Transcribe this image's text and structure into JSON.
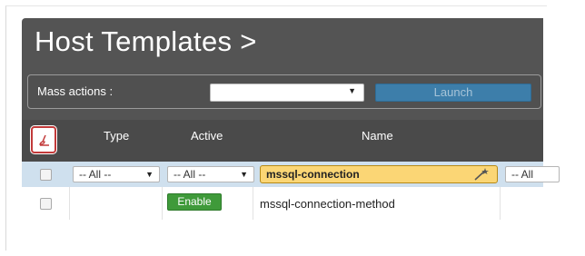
{
  "header": {
    "title": "Host Templates >"
  },
  "mass_actions": {
    "label": "Mass actions :",
    "selected": "",
    "launch_label": "Launch"
  },
  "table": {
    "columns": [
      "Type",
      "Active",
      "Name"
    ],
    "filters": {
      "type": "-- All --",
      "active": "-- All --",
      "name": "mssql-connection",
      "next": "-- All"
    },
    "rows": [
      {
        "type": "",
        "active": "Enable",
        "name": "mssql-connection-method"
      }
    ]
  },
  "icons": {
    "clear_filters": "broom-icon",
    "filter_wand": "magic-wand-icon"
  },
  "colors": {
    "header_bg": "#545454",
    "name_filter_bg": "#fbd675",
    "enable_bg": "#3f9a3a",
    "launch_bg": "#3d7eaa"
  }
}
